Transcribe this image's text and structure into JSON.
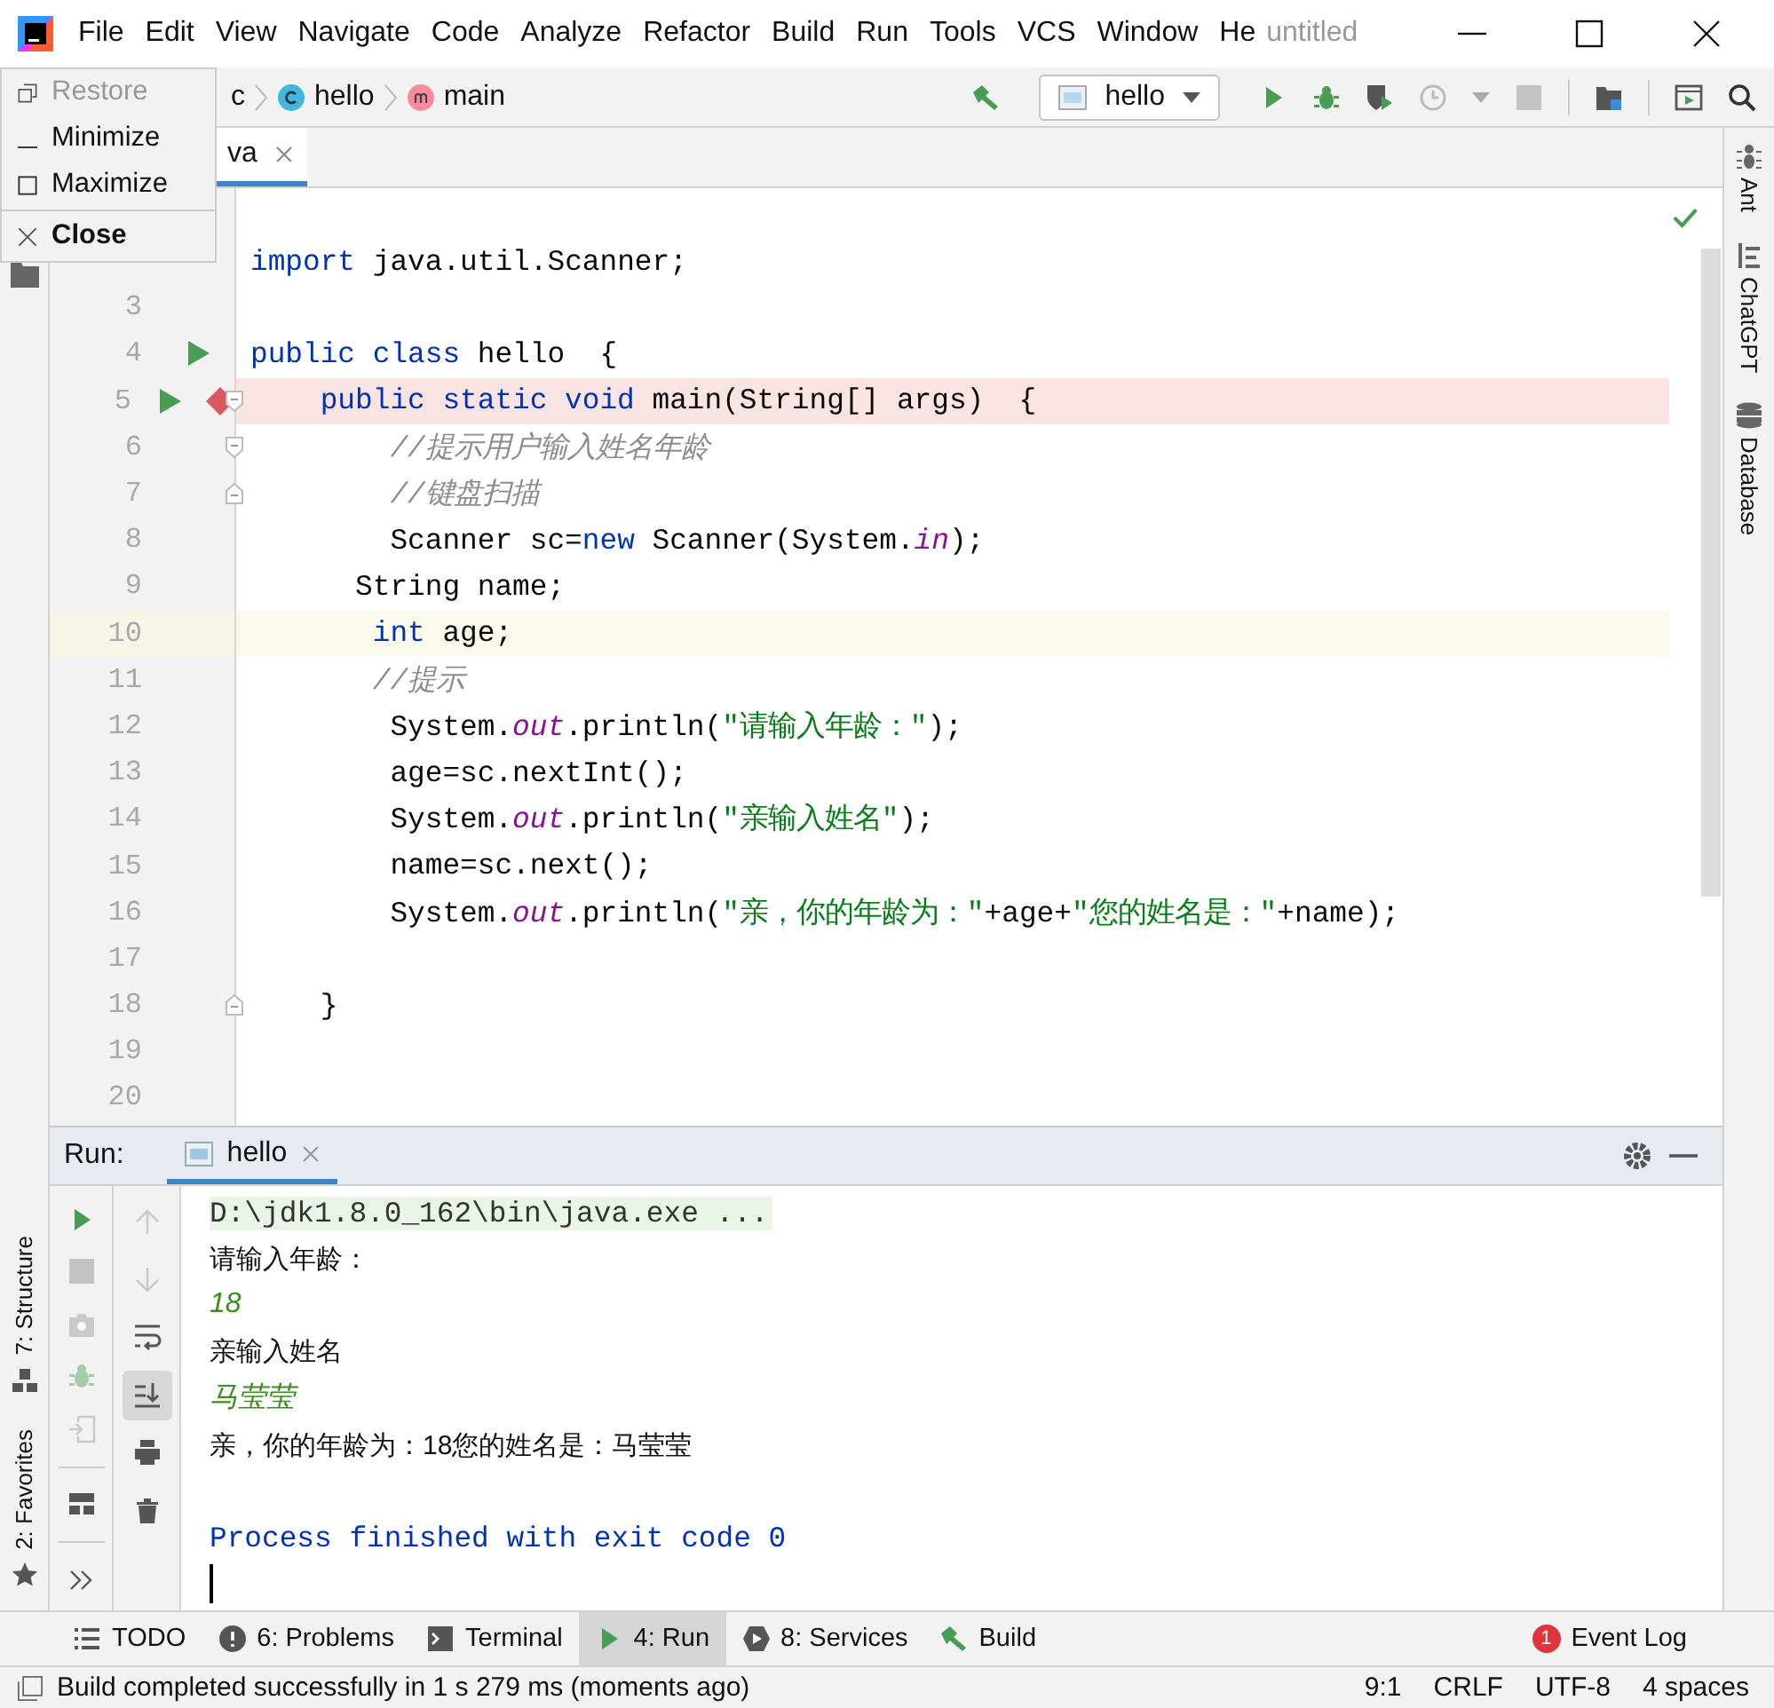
{
  "title_bar": {
    "menu": [
      "File",
      "Edit",
      "View",
      "Navigate",
      "Code",
      "Analyze",
      "Refactor",
      "Build",
      "Run",
      "Tools",
      "VCS",
      "Window",
      "He"
    ],
    "title": "untitled"
  },
  "system_menu": {
    "items": [
      {
        "label": "Restore",
        "kind": "restore",
        "disabled": true,
        "default": false
      },
      {
        "label": "Minimize",
        "kind": "minimize",
        "disabled": false,
        "default": false
      },
      {
        "label": "Maximize",
        "kind": "maximize",
        "disabled": false,
        "default": false
      },
      {
        "label": "Close",
        "kind": "close",
        "disabled": false,
        "default": true
      }
    ]
  },
  "breadcrumbs": [
    {
      "label": "c",
      "kind": "folder"
    },
    {
      "label": "hello",
      "kind": "class"
    },
    {
      "label": "main",
      "kind": "method"
    }
  ],
  "toolbar": [
    {
      "kind": "build",
      "disabled": false
    },
    {
      "kind": "config",
      "label": "hello",
      "disabled": false
    },
    {
      "kind": "run",
      "disabled": false
    },
    {
      "kind": "debug",
      "disabled": false
    },
    {
      "kind": "coverage",
      "disabled": false
    },
    {
      "kind": "profile",
      "disabled": true
    },
    {
      "kind": "stop",
      "disabled": true
    },
    {
      "kind": "project",
      "disabled": false
    },
    {
      "kind": "frame",
      "disabled": false
    },
    {
      "kind": "search",
      "disabled": false
    }
  ],
  "editor_tabs": [
    {
      "label": "va",
      "selected": true
    }
  ],
  "editor": {
    "lines": [
      {
        "current": false,
        "breakpoint": false,
        "run_marker": false,
        "fold_open": false,
        "fold_close": false,
        "segments": [
          {
            "kind": "keyword",
            "text": "import"
          },
          {
            "kind": "plain",
            "text": " java.util.Scanner;"
          }
        ]
      },
      {
        "number": "3",
        "current": false,
        "breakpoint": false,
        "run_marker": false,
        "fold_open": false,
        "fold_close": false
      },
      {
        "number": "4",
        "current": false,
        "breakpoint": false,
        "run_marker": true,
        "fold_open": false,
        "fold_close": false,
        "segments": [
          {
            "kind": "keyword",
            "text": "public class"
          },
          {
            "kind": "plain",
            "text": " hello  {"
          }
        ]
      },
      {
        "number": "5",
        "current": false,
        "breakpoint": true,
        "run_marker": true,
        "fold_open": true,
        "fold_close": false,
        "segments": [
          {
            "kind": "keyword",
            "text": "    public static void"
          },
          {
            "kind": "plain",
            "text": " main(String[] args)  {"
          }
        ]
      },
      {
        "number": "6",
        "current": false,
        "breakpoint": false,
        "run_marker": false,
        "fold_open": true,
        "fold_close": false,
        "segments": [
          {
            "kind": "comment",
            "text": "        //提示用户输入姓名年龄"
          }
        ]
      },
      {
        "number": "7",
        "current": false,
        "breakpoint": false,
        "run_marker": false,
        "fold_open": false,
        "fold_close": true,
        "segments": [
          {
            "kind": "comment",
            "text": "        //键盘扫描"
          }
        ]
      },
      {
        "number": "8",
        "current": false,
        "breakpoint": false,
        "run_marker": false,
        "fold_open": false,
        "fold_close": false,
        "segments": [
          {
            "kind": "plain",
            "text": "        Scanner sc="
          },
          {
            "kind": "keyword",
            "text": "new"
          },
          {
            "kind": "plain",
            "text": " Scanner(System."
          },
          {
            "kind": "field",
            "text": "in"
          },
          {
            "kind": "plain",
            "text": ");"
          }
        ]
      },
      {
        "number": "9",
        "current": false,
        "breakpoint": false,
        "run_marker": false,
        "fold_open": false,
        "fold_close": false,
        "segments": [
          {
            "kind": "plain",
            "text": "      String name;"
          }
        ]
      },
      {
        "number": "10",
        "current": true,
        "breakpoint": false,
        "run_marker": false,
        "fold_open": false,
        "fold_close": false,
        "segments": [
          {
            "kind": "keyword",
            "text": "       int"
          },
          {
            "kind": "plain",
            "text": " age;"
          }
        ]
      },
      {
        "number": "11",
        "current": false,
        "breakpoint": false,
        "run_marker": false,
        "fold_open": false,
        "fold_close": false,
        "segments": [
          {
            "kind": "comment",
            "text": "       //提示"
          }
        ]
      },
      {
        "number": "12",
        "current": false,
        "breakpoint": false,
        "run_marker": false,
        "fold_open": false,
        "fold_close": false,
        "segments": [
          {
            "kind": "plain",
            "text": "        System."
          },
          {
            "kind": "field",
            "text": "out"
          },
          {
            "kind": "plain",
            "text": ".println("
          },
          {
            "kind": "string",
            "text": "\"请输入年龄：\""
          },
          {
            "kind": "plain",
            "text": ");"
          }
        ]
      },
      {
        "number": "13",
        "current": false,
        "breakpoint": false,
        "run_marker": false,
        "fold_open": false,
        "fold_close": false,
        "segments": [
          {
            "kind": "plain",
            "text": "        age=sc.nextInt();"
          }
        ]
      },
      {
        "number": "14",
        "current": false,
        "breakpoint": false,
        "run_marker": false,
        "fold_open": false,
        "fold_close": false,
        "segments": [
          {
            "kind": "plain",
            "text": "        System."
          },
          {
            "kind": "field",
            "text": "out"
          },
          {
            "kind": "plain",
            "text": ".println("
          },
          {
            "kind": "string",
            "text": "\"亲输入姓名\""
          },
          {
            "kind": "plain",
            "text": ");"
          }
        ]
      },
      {
        "number": "15",
        "current": false,
        "breakpoint": false,
        "run_marker": false,
        "fold_open": false,
        "fold_close": false,
        "segments": [
          {
            "kind": "plain",
            "text": "        name=sc.next();"
          }
        ]
      },
      {
        "number": "16",
        "current": false,
        "breakpoint": false,
        "run_marker": false,
        "fold_open": false,
        "fold_close": false,
        "segments": [
          {
            "kind": "plain",
            "text": "        System."
          },
          {
            "kind": "field",
            "text": "out"
          },
          {
            "kind": "plain",
            "text": ".println("
          },
          {
            "kind": "string",
            "text": "\"亲，你的年龄为：\""
          },
          {
            "kind": "plain",
            "text": "+age+"
          },
          {
            "kind": "string",
            "text": "\"您的姓名是：\""
          },
          {
            "kind": "plain",
            "text": "+name);"
          }
        ]
      },
      {
        "number": "17",
        "current": false,
        "breakpoint": false,
        "run_marker": false,
        "fold_open": false,
        "fold_close": false
      },
      {
        "number": "18",
        "current": false,
        "breakpoint": false,
        "run_marker": false,
        "fold_open": false,
        "fold_close": true,
        "segments": [
          {
            "kind": "plain",
            "text": "    }"
          }
        ]
      },
      {
        "number": "19",
        "current": false,
        "breakpoint": false,
        "run_marker": false,
        "fold_open": false,
        "fold_close": false
      },
      {
        "number": "20",
        "current": false,
        "breakpoint": false,
        "run_marker": false,
        "fold_open": false,
        "fold_close": false
      }
    ]
  },
  "right_stripe": [
    {
      "label": "Ant",
      "kind": "ant"
    },
    {
      "label": "ChatGPT",
      "kind": "chatgpt"
    },
    {
      "label": "Database",
      "kind": "database"
    }
  ],
  "left_stripe": [
    {
      "label": "7: Structure",
      "kind": "structure"
    },
    {
      "label": "2: Favorites",
      "kind": "favorites"
    }
  ],
  "run_panel": {
    "label": "Run:",
    "tabs": [
      {
        "label": "hello",
        "selected": true
      }
    ],
    "actions": [
      {
        "kind": "rerun",
        "disabled": false
      },
      {
        "kind": "stop",
        "disabled": true
      },
      {
        "kind": "camera",
        "disabled": true
      },
      {
        "kind": "attach",
        "disabled": true
      },
      {
        "kind": "exit",
        "disabled": true
      },
      {
        "kind": "layout",
        "disabled": false
      },
      {
        "kind": "more",
        "disabled": false
      }
    ],
    "output_actions": [
      {
        "kind": "up",
        "disabled": true,
        "selected": false
      },
      {
        "kind": "down",
        "disabled": true,
        "selected": false
      },
      {
        "kind": "wrap",
        "disabled": false,
        "selected": false
      },
      {
        "kind": "scroll_end",
        "disabled": false,
        "selected": true
      },
      {
        "kind": "print",
        "disabled": false,
        "selected": false
      },
      {
        "kind": "trash",
        "disabled": false,
        "selected": false
      }
    ],
    "console": [
      {
        "kind": "command",
        "text": "D:\\jdk1.8.0_162\\bin\\java.exe ..."
      },
      {
        "kind": "output",
        "text": "请输入年龄："
      },
      {
        "kind": "input",
        "text": "18"
      },
      {
        "kind": "output",
        "text": "亲输入姓名"
      },
      {
        "kind": "input",
        "text": "马莹莹"
      },
      {
        "kind": "output",
        "text": "亲，你的年龄为：18您的姓名是：马莹莹"
      },
      {
        "kind": "exit",
        "text": "Process finished with exit code 0"
      }
    ]
  },
  "bottom_tools": [
    {
      "label": "TODO",
      "kind": "todo",
      "selected": false
    },
    {
      "label": "6: Problems",
      "kind": "problems",
      "selected": false
    },
    {
      "label": "Terminal",
      "kind": "terminal",
      "selected": false
    },
    {
      "label": "4: Run",
      "kind": "run",
      "selected": true
    },
    {
      "label": "8: Services",
      "kind": "services",
      "selected": false
    },
    {
      "label": "Build",
      "kind": "build",
      "selected": false
    }
  ],
  "event_log": {
    "label": "Event Log",
    "badge": "1"
  },
  "status_bar": {
    "message": "Build completed successfully in 1 s 279 ms (moments ago)",
    "items": [
      "9:1",
      "CRLF",
      "UTF-8",
      "4 spaces"
    ]
  }
}
